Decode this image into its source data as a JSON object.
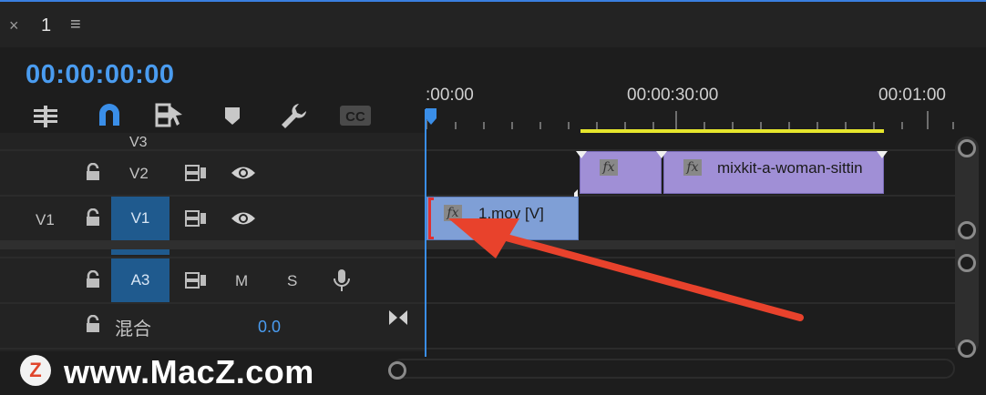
{
  "tab": {
    "close": "×",
    "name": "1",
    "menu": "≡"
  },
  "timecode": "00:00:00:00",
  "ruler": {
    "labels": [
      ":00:00",
      "00:00:30:00",
      "00:01:00"
    ]
  },
  "tracks": {
    "v3": {
      "label": "V3"
    },
    "v2": {
      "label": "V2"
    },
    "v1": {
      "source": "V1",
      "label": "V1"
    },
    "a3": {
      "label": "A3",
      "mute": "M",
      "solo": "S"
    },
    "mix": {
      "label": "混合",
      "value": "0.0"
    }
  },
  "clips": {
    "v2_clip_a_fx": "fx",
    "v2_clip_b_fx": "fx",
    "v2_clip_b_name": "mixkit-a-woman-sittin",
    "v1_clip_fx": "fx",
    "v1_clip_name": "1.mov [V]"
  },
  "watermark": {
    "logo": "Z",
    "text": "www.MacZ.com"
  },
  "colors": {
    "accent": "#4a9cf0",
    "clip_purple": "#a08fd6",
    "clip_blue": "#7f9fd6",
    "work_area": "#e6e62c",
    "arrow": "#e8422c"
  }
}
